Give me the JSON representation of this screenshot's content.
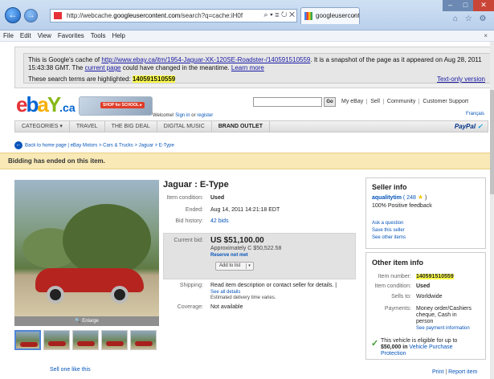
{
  "browser": {
    "address_prefix": "http://webcache.",
    "address_domain": "googleusercontent.com",
    "address_suffix": "/search?q=cache:iH0f",
    "address_ctrls": "⌕ ▾ ≣ ↻ ✕",
    "tab_label": "googleusercontent.com",
    "tab_close": "×",
    "back_glyph": "←",
    "fwd_glyph": "→",
    "min_glyph": "–",
    "max_glyph": "□",
    "close_glyph": "✕",
    "tools_glyphs": "⌂ ☆ ⚙"
  },
  "menu": {
    "file": "File",
    "edit": "Edit",
    "view": "View",
    "favorites": "Favorites",
    "tools": "Tools",
    "help": "Help",
    "close": "×"
  },
  "cache": {
    "line1_pre": "This is Google's cache of ",
    "line1_url": "http://www.ebay.ca/itm/1954-Jaguar-XK-120SE-Roadster-/140591510559",
    "line1_post": ". It is a snapshot of the page as it appeared on Aug 28, 2011",
    "line2_pre": "15:43:38 GMT. The ",
    "line2_link": "current page",
    "line2_mid": " could have changed in the meantime. ",
    "line2_learn": "Learn more",
    "terms_label": "These search terms are highlighted: ",
    "terms_value": "140591510559",
    "text_only": "Text-only version"
  },
  "header": {
    "logo_e": "e",
    "logo_b": "b",
    "logo_a": "a",
    "logo_y": "Y",
    "logo_ca": ".ca",
    "promo_label": "SHOP for SCHOOL ▸",
    "welcome_pre": "Welcome! ",
    "welcome_sign": "Sign in",
    "welcome_or": " or ",
    "welcome_reg": "register",
    "go": "Go",
    "my_ebay": "My eBay",
    "sell": "Sell",
    "community": "Community",
    "support": "Customer Support",
    "francais": "Français"
  },
  "categories": {
    "categories": "CATEGORIES ▾",
    "travel": "TRAVEL",
    "big_deal": "THE BIG DEAL",
    "digital_music": "DIGITAL MUSIC",
    "brand_outlet": "BRAND OUTLET",
    "paypal_pay": "PayPal",
    "paypal_badge": "✓"
  },
  "breadcrumb": {
    "back_glyph": "←",
    "text": "Back to home page | eBay Motors > Cars & Trucks > Jaguar > E-Type"
  },
  "status": {
    "ended": "Bidding has ended on this item."
  },
  "photo": {
    "enlarge": "🔍 Enlarge",
    "sell_one": "Sell one like this"
  },
  "item": {
    "title": "Jaguar : E-Type",
    "condition_label": "Item condition:",
    "condition_value": "Used",
    "ended_label": "Ended:",
    "ended_value": "Aug 14, 2011 14:21:18 EDT",
    "bid_history_label": "Bid history:",
    "bid_history_value": "42 bids",
    "current_bid_label": "Current bid:",
    "current_bid_value": "US $51,100.00",
    "approx": "Approximately C $50,522.58",
    "reserve": "Reserve not met",
    "add_to_list": "Add to list",
    "add_arrow": "▾",
    "shipping_label": "Shipping:",
    "shipping_value": "Read item description or contact seller for details. |",
    "see_all": "See all details",
    "estimated": "Estimated delivery time varies.",
    "coverage_label": "Coverage:",
    "coverage_value": "Not available"
  },
  "seller": {
    "title": "Seller info",
    "name": "aqualitytim",
    "feedback_count": "( 248",
    "star": "★",
    "feedback_close": ")",
    "positive": "100% Positive feedback",
    "ask": "Ask a question",
    "save": "Save this seller",
    "other": "See other items"
  },
  "other_info": {
    "title": "Other item info",
    "number_label": "Item number:",
    "number_value": "140591510559",
    "condition_label": "Item condition:",
    "condition_value": "Used",
    "sells_label": "Sells to:",
    "sells_value": "Worldwide",
    "payments_label": "Payments:",
    "payments_line1": "Money order/Cashiers",
    "payments_line2": "cheque, Cash in",
    "payments_line3": "person",
    "payments_link": "See payment information",
    "check": "✓",
    "eligible_line1": "This vehicle is eligible for up to",
    "eligible_amount": "$50,000 in ",
    "eligible_link1": "Vehicle Purchase",
    "eligible_link2": "Protection"
  },
  "footer": {
    "print": "Print",
    "sep": " | ",
    "report": "Report item"
  }
}
